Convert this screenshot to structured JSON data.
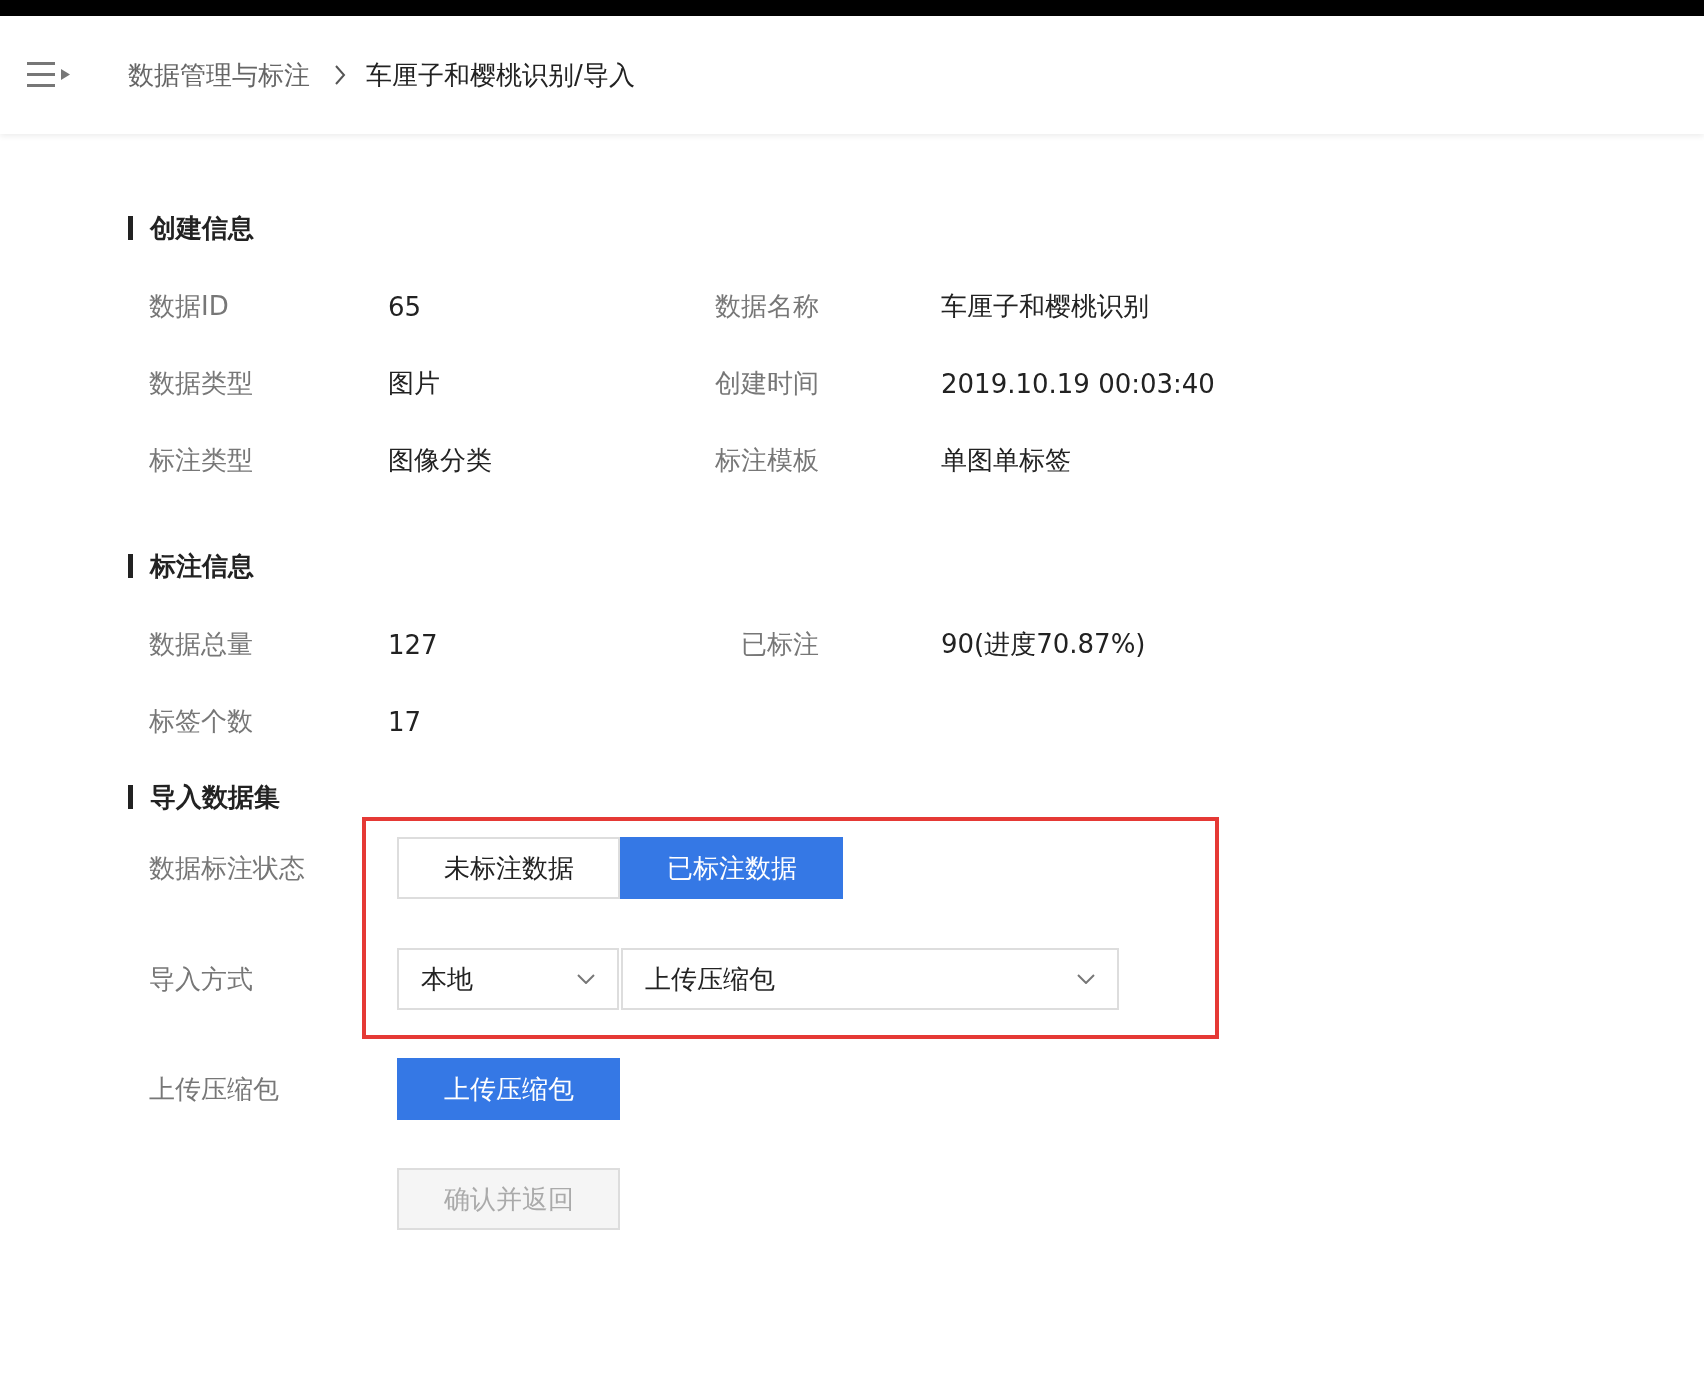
{
  "breadcrumb": [
    {
      "label": "数据管理与标注",
      "current": false
    },
    {
      "label": "车厘子和樱桃识别/导入",
      "current": true
    }
  ],
  "sections": [
    {
      "title": "创建信息",
      "rows": [
        {
          "fields": [
            {
              "label": "数据ID",
              "value": "65"
            },
            {
              "label": "数据名称",
              "value": "车厘子和樱桃识别"
            }
          ]
        },
        {
          "fields": [
            {
              "label": "数据类型",
              "value": "图片"
            },
            {
              "label": "创建时间",
              "value": "2019.10.19 00:03:40"
            }
          ]
        },
        {
          "fields": [
            {
              "label": "标注类型",
              "value": "图像分类"
            },
            {
              "label": "标注模板",
              "value": "单图单标签"
            }
          ]
        }
      ]
    },
    {
      "title": "标注信息",
      "rows": [
        {
          "fields": [
            {
              "label": "数据总量",
              "value": "127"
            },
            {
              "label": "已标注",
              "value": "90(进度70.87%)"
            }
          ]
        },
        {
          "fields": [
            {
              "label": "标签个数",
              "value": "17"
            }
          ]
        }
      ]
    }
  ],
  "import": {
    "title": "导入数据集",
    "status": {
      "label": "数据标注状态",
      "options": [
        {
          "label": "未标注数据",
          "selected": false
        },
        {
          "label": "已标注数据",
          "selected": true
        }
      ]
    },
    "method": {
      "label": "导入方式",
      "source": "本地",
      "type": "上传压缩包"
    },
    "upload": {
      "label": "上传压缩包",
      "button": "上传压缩包"
    },
    "confirm": {
      "label": "确认并返回",
      "disabled": true
    }
  }
}
